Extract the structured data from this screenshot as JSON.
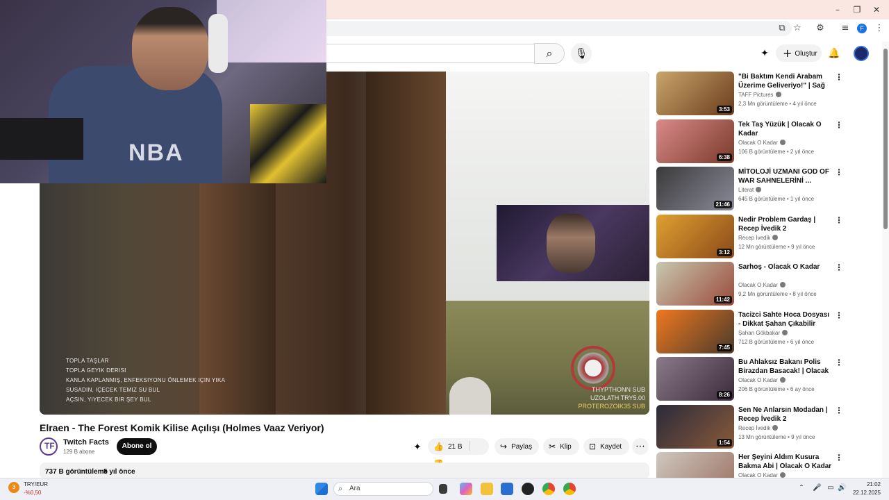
{
  "window": {
    "minimize": "–",
    "maximize": "❐",
    "close": "✕"
  },
  "toolbar": {
    "install_icon": "⧉",
    "star_icon": "☆",
    "ext_icon": "⚙",
    "media_icon": "≡",
    "profile_initial": "F",
    "menu_icon": "⋮"
  },
  "youtube_header": {
    "search_icon": "⌕",
    "mic_icon": "🎙",
    "create_label": "Oluştur",
    "create_plus": "+",
    "bell_icon": "🔔",
    "sparkle_icon": "✦"
  },
  "player": {
    "overlay_lines": [
      "TOPLA TAŞLAR",
      "TOPLA GEYIK DERISI",
      "KANLA KAPLANMIŞ, ENFEKSIYONU ÖNLEMEK IÇIN YIKA",
      "SUSADIN, IÇECEK TEMIZ SU BUL",
      "AÇSIN, YIYECEK BIR ŞEY BUL"
    ],
    "subs": [
      {
        "name": "THYPTHONN",
        "tag": "SUB"
      },
      {
        "name": "UZOLATH",
        "tag": "TRY5.00"
      },
      {
        "name": "PROTEROZOIK35",
        "tag": "SUB"
      }
    ],
    "webcam_shirt": "NBA"
  },
  "video": {
    "title": "Elraen - The Forest Komik Kilise Açılışı (Holmes Vaaz Veriyor)",
    "channel": "Twitch Facts",
    "channel_initial": "TF",
    "subscribers": "129 B abone",
    "subscribe_label": "Abone ol",
    "likes": "21 B",
    "share_label": "Paylaş",
    "clip_label": "Klip",
    "save_label": "Kaydet",
    "more_icon": "⋯",
    "views": "737 B görüntüleme",
    "ago": "5 yıl önce"
  },
  "recommendations": [
    {
      "title": "\"Bi Baktım Kendi Arabam Üzerime Geliveriyo!\" | Sağ Sali...",
      "channel": "TAFF Pictures",
      "verified": true,
      "meta": "2,3 Mn görüntüleme • 4 yıl önce",
      "duration": "3:53",
      "color1": "#c9a56a",
      "color2": "#6a3d1e"
    },
    {
      "title": "Tek Taş Yüzük | Olacak O Kadar",
      "channel": "Olacak O Kadar",
      "verified": true,
      "meta": "106 B görüntüleme • 2 yıl önce",
      "duration": "6:38",
      "color1": "#d98a8a",
      "color2": "#7a3a2a"
    },
    {
      "title": "MİTOLOJİ UZMANI GOD OF WAR SAHNELERİNİ ...",
      "channel": "Literat",
      "verified": true,
      "meta": "645 B görüntüleme • 1 yıl önce",
      "duration": "21:46",
      "color1": "#3a3a3a",
      "color2": "#8a8a9a"
    },
    {
      "title": "Nedir Problem Gardaş | Recep İvedik 2",
      "channel": "Recep İvedik",
      "verified": true,
      "meta": "12 Mn görüntüleme • 9 yıl önce",
      "duration": "3:12",
      "color1": "#e0a030",
      "color2": "#8a4a1a"
    },
    {
      "title": "Sarhoş - Olacak O Kadar",
      "channel": "Olacak O Kadar",
      "verified": true,
      "meta": "9,2 Mn görüntüleme • 8 yıl önce",
      "duration": "11:42",
      "color1": "#c8c8b0",
      "color2": "#9a4a3a"
    },
    {
      "title": "Tacizci Sahte Hoca Dosyası - Dikkat Şahan Çıkabilir",
      "channel": "Şahan Gökbakar",
      "verified": true,
      "meta": "712 B görüntüleme • 6 yıl önce",
      "duration": "7:45",
      "color1": "#f07820",
      "color2": "#4a3a2a"
    },
    {
      "title": "Bu Ahlaksız Bakanı Polis Birazdan Basacak! | Olacak O ...",
      "channel": "Olacak O Kadar",
      "verified": true,
      "meta": "206 B görüntüleme • 6 ay önce",
      "duration": "8:26",
      "color1": "#8a7a8a",
      "color2": "#3a2a3a"
    },
    {
      "title": "Sen Ne Anlarsın Modadan | Recep İvedik 2",
      "channel": "Recep İvedik",
      "verified": true,
      "meta": "13 Mn görüntüleme • 9 yıl önce",
      "duration": "1:54",
      "color1": "#2a2a3a",
      "color2": "#8a5a3a"
    },
    {
      "title": "Her Şeyini Aldım Kusura Bakma Abi | Olacak O Kadar",
      "channel": "Olacak O Kadar",
      "verified": true,
      "meta": "",
      "duration": "",
      "color1": "#d0c8c0",
      "color2": "#9a7060"
    }
  ],
  "taskbar": {
    "currency": "TRY/EUR",
    "change": "-%0,50",
    "badge": "3",
    "search_placeholder": "Ara",
    "search_icon": "⌕",
    "time": "21:02",
    "date": "22.12.2025",
    "tray_chevron": "⌃",
    "tray_mic": "🎤",
    "tray_display": "▭",
    "tray_speaker": "🔊"
  },
  "colors": {
    "accent": "#ff0000",
    "taskbar_bg": "#eef0f5",
    "title_bg": "#fbe7e1"
  }
}
